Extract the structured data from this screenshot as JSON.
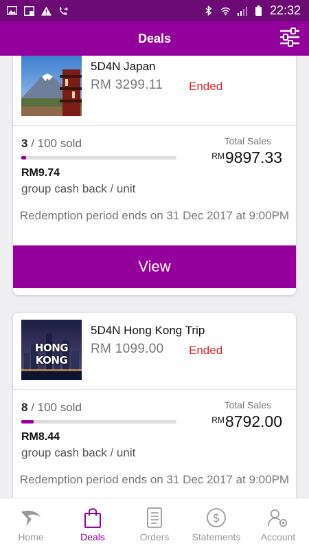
{
  "status_bar": {
    "time": "22:32"
  },
  "app_bar": {
    "title": "Deals"
  },
  "deals": [
    {
      "title": "5D4N Japan",
      "price": "RM 3299.11",
      "status": "Ended",
      "sold_count": "3",
      "sold_total": " / 100 sold",
      "sold_fraction": 0.03,
      "total_sales_label": "Total Sales",
      "currency": "RM",
      "total_sales": "9897.33",
      "cashback_amount": "RM9.74",
      "cashback_label": "group cash back / unit",
      "redemption": "Redemption period ends on 31 Dec 2017 at 9:00PM",
      "button": "View"
    },
    {
      "title": "5D4N Hong Kong Trip",
      "price": "RM 1099.00",
      "status": "Ended",
      "thumb_text": "HONG KONG",
      "sold_count": "8",
      "sold_total": " / 100 sold",
      "sold_fraction": 0.08,
      "total_sales_label": "Total Sales",
      "currency": "RM",
      "total_sales": "8792.00",
      "cashback_amount": "RM8.44",
      "cashback_label": "group cash back / unit",
      "redemption": "Redemption period ends on 31 Dec 2017 at 9:00PM"
    }
  ],
  "bottom_nav": [
    {
      "label": "Home",
      "icon": "home-icon"
    },
    {
      "label": "Deals",
      "icon": "shopping-bag-icon",
      "active": true
    },
    {
      "label": "Orders",
      "icon": "orders-icon"
    },
    {
      "label": "Statements",
      "icon": "dollar-icon"
    },
    {
      "label": "Account",
      "icon": "account-settings-icon"
    }
  ],
  "colors": {
    "primary": "#94009b",
    "status_bar": "#6d0b76",
    "ended": "#d8242a"
  }
}
